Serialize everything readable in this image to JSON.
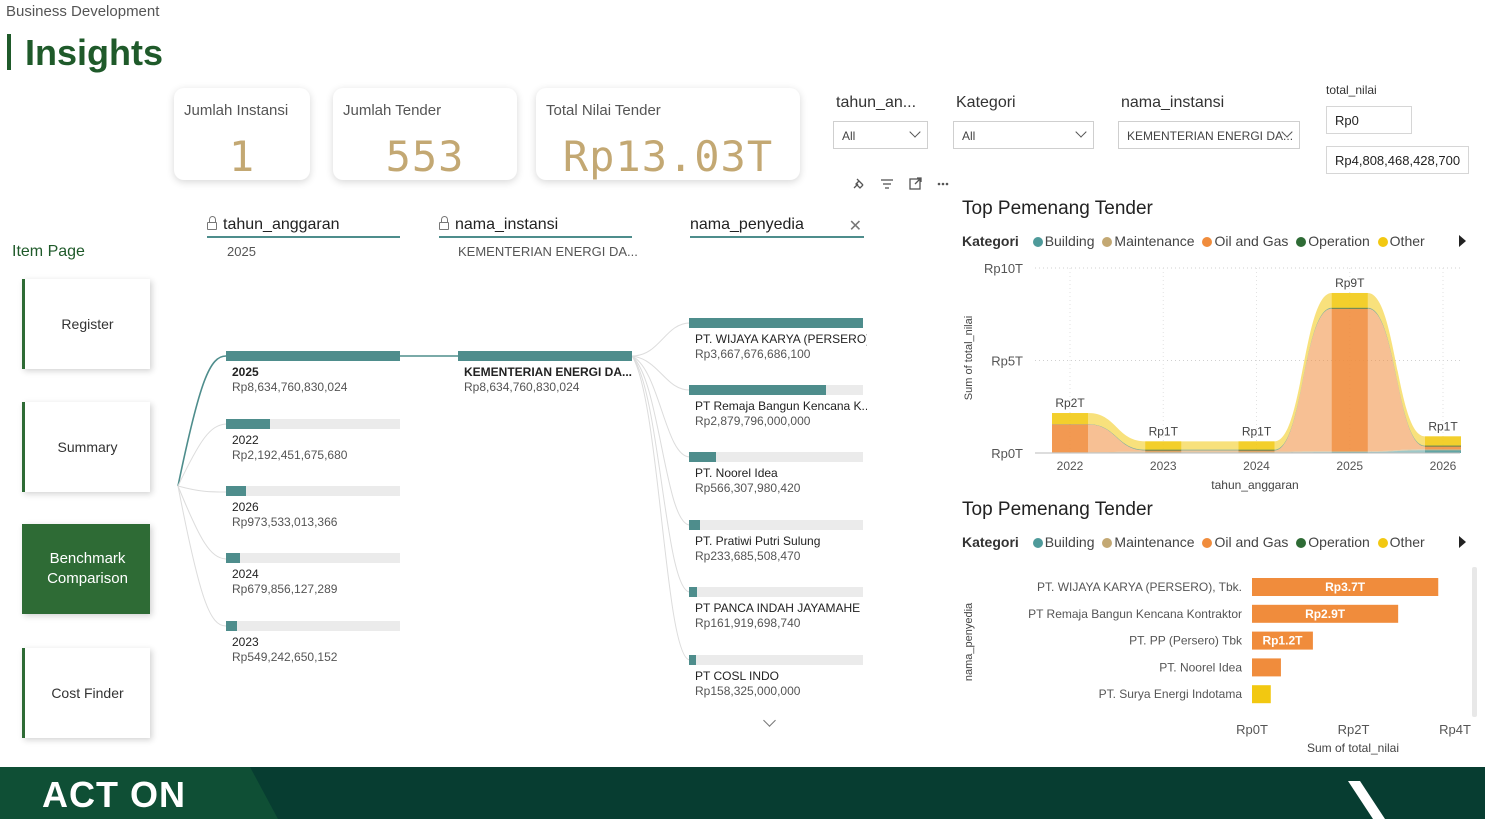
{
  "breadcrumb": "Business Development",
  "page_title": "Insights",
  "kpis": [
    {
      "label": "Jumlah Instansi",
      "value": "1"
    },
    {
      "label": "Jumlah Tender",
      "value": "553"
    },
    {
      "label": "Total Nilai Tender",
      "value": "Rp13.03T"
    }
  ],
  "slicers": {
    "tahun": {
      "label": "tahun_an...",
      "value": "All"
    },
    "kategori": {
      "label": "Kategori",
      "value": "All"
    },
    "instansi": {
      "label": "nama_instansi",
      "value": "KEMENTERIAN ENERGI DA..."
    },
    "total_nilai": {
      "label": "total_nilai",
      "min": "Rp0",
      "max": "Rp4,808,468,428,700"
    }
  },
  "sidebar": {
    "heading": "Item Page",
    "items": [
      {
        "label": "Register",
        "active": false
      },
      {
        "label": "Summary",
        "active": false
      },
      {
        "label": "Benchmark Comparison",
        "active": true
      },
      {
        "label": "Cost Finder",
        "active": false
      }
    ]
  },
  "decomp": {
    "columns": [
      {
        "head": "tahun_anggaran",
        "sub": "2025",
        "locked": true
      },
      {
        "head": "nama_instansi",
        "sub": "KEMENTERIAN ENERGI DA...",
        "locked": true
      },
      {
        "head": "nama_penyedia",
        "sub": "",
        "locked": false
      }
    ],
    "years": [
      {
        "label": "2025",
        "value": "Rp8,634,760,830,024",
        "share": 1.0
      },
      {
        "label": "2022",
        "value": "Rp2,192,451,675,680",
        "share": 0.254
      },
      {
        "label": "2026",
        "value": "Rp973,533,013,366",
        "share": 0.113
      },
      {
        "label": "2024",
        "value": "Rp679,856,127,289",
        "share": 0.079
      },
      {
        "label": "2023",
        "value": "Rp549,242,650,152",
        "share": 0.064
      }
    ],
    "instansi": [
      {
        "label": "KEMENTERIAN ENERGI DA...",
        "value": "Rp8,634,760,830,024",
        "share": 1.0
      }
    ],
    "penyedia": [
      {
        "label": "PT. WIJAYA KARYA (PERSERO),...",
        "value": "Rp3,667,676,686,100",
        "share": 1.0
      },
      {
        "label": "PT Remaja Bangun Kencana K...",
        "value": "Rp2,879,796,000,000",
        "share": 0.785
      },
      {
        "label": "PT. Noorel Idea",
        "value": "Rp566,307,980,420",
        "share": 0.154
      },
      {
        "label": "PT. Pratiwi Putri Sulung",
        "value": "Rp233,685,508,470",
        "share": 0.064
      },
      {
        "label": "PT PANCA INDAH JAYAMAHE",
        "value": "Rp161,919,698,740",
        "share": 0.044
      },
      {
        "label": "PT COSL INDO",
        "value": "Rp158,325,000,000",
        "share": 0.043
      }
    ]
  },
  "legend": {
    "title": "Kategori",
    "items": [
      {
        "name": "Building",
        "color": "#4e9a9a"
      },
      {
        "name": "Maintenance",
        "color": "#c3a873"
      },
      {
        "name": "Oil and Gas",
        "color": "#f08c3c"
      },
      {
        "name": "Operation",
        "color": "#2e6b35"
      },
      {
        "name": "Other",
        "color": "#f2c811"
      }
    ]
  },
  "chart_data": [
    {
      "type": "area",
      "title": "Top Pemenang Tender",
      "xlabel": "tahun_anggaran",
      "ylabel": "Sum of total_nilai",
      "categories": [
        "2022",
        "2023",
        "2024",
        "2025",
        "2026"
      ],
      "y_ticks": [
        "Rp10T",
        "Rp5T",
        "Rp0T"
      ],
      "ylim": [
        0,
        10
      ],
      "y_unit": "T",
      "data_labels": [
        "Rp2T",
        "Rp1T",
        "Rp1T",
        "Rp9T",
        "Rp1T"
      ],
      "series": [
        {
          "name": "Building",
          "color": "#4e9a9a",
          "values": [
            0.02,
            0.03,
            0.03,
            0.05,
            0.15
          ]
        },
        {
          "name": "Maintenance",
          "color": "#c3a873",
          "values": [
            0.02,
            0.05,
            0.05,
            0.05,
            0.05
          ]
        },
        {
          "name": "Oil and Gas",
          "color": "#f08c3c",
          "values": [
            1.5,
            0.05,
            0.05,
            7.7,
            0.15
          ]
        },
        {
          "name": "Operation",
          "color": "#2e6b35",
          "values": [
            0.02,
            0.05,
            0.05,
            0.05,
            0.05
          ]
        },
        {
          "name": "Other",
          "color": "#f2c811",
          "values": [
            0.6,
            0.45,
            0.45,
            0.8,
            0.5
          ]
        }
      ],
      "legend_position": "top"
    },
    {
      "type": "bar",
      "orientation": "horizontal",
      "title": "Top Pemenang Tender",
      "xlabel": "Sum of total_nilai",
      "ylabel": "nama_penyedia",
      "categories": [
        "PT. WIJAYA KARYA (PERSERO), Tbk.",
        "PT Remaja Bangun Kencana Kontraktor",
        "PT. PP (Persero) Tbk",
        "PT. Noorel Idea",
        "PT. Surya Energi Indotama"
      ],
      "values": [
        3.67,
        2.88,
        1.2,
        0.57,
        0.37
      ],
      "colors": [
        "#f08c3c",
        "#f08c3c",
        "#f08c3c",
        "#f08c3c",
        "#f2c811"
      ],
      "data_labels": [
        "Rp3.7T",
        "Rp2.9T",
        "Rp1.2T",
        "",
        ""
      ],
      "x_ticks": [
        "Rp0T",
        "Rp2T",
        "Rp4T"
      ],
      "xlim": [
        0,
        4
      ],
      "legend_position": "top"
    }
  ],
  "footer": {
    "brand": "ACT ON"
  }
}
